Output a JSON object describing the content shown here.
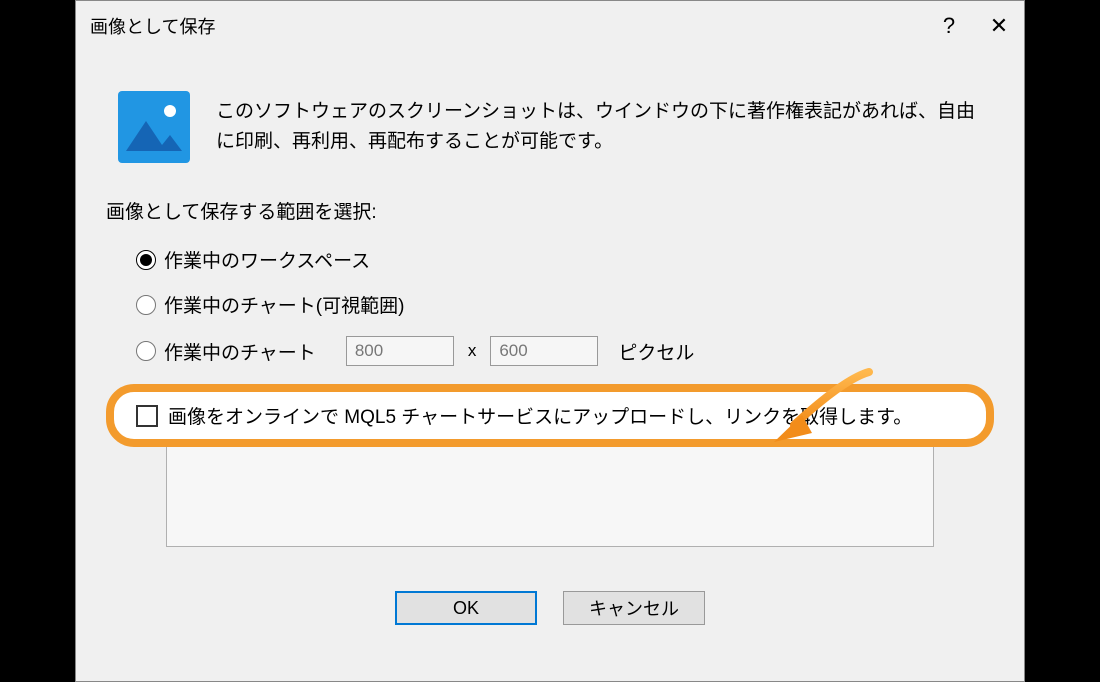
{
  "dialog": {
    "title": "画像として保存",
    "intro": "このソフトウェアのスクリーンショットは、ウインドウの下に著作権表記があれば、自由に印刷、再利用、再配布することが可能です。",
    "section_label": "画像として保存する範囲を選択:",
    "options": {
      "workspace": "作業中のワークスペース",
      "chart_visible": "作業中のチャート(可視範囲)",
      "chart_custom": "作業中のチャート",
      "width": "800",
      "height": "600",
      "pixel_label": "ピクセル"
    },
    "upload_checkbox": "画像をオンラインで MQL5 チャートサービスにアップロードし、リンクを取得します。",
    "buttons": {
      "ok": "OK",
      "cancel": "キャンセル"
    },
    "titlebar": {
      "help": "?",
      "close": "✕"
    }
  }
}
